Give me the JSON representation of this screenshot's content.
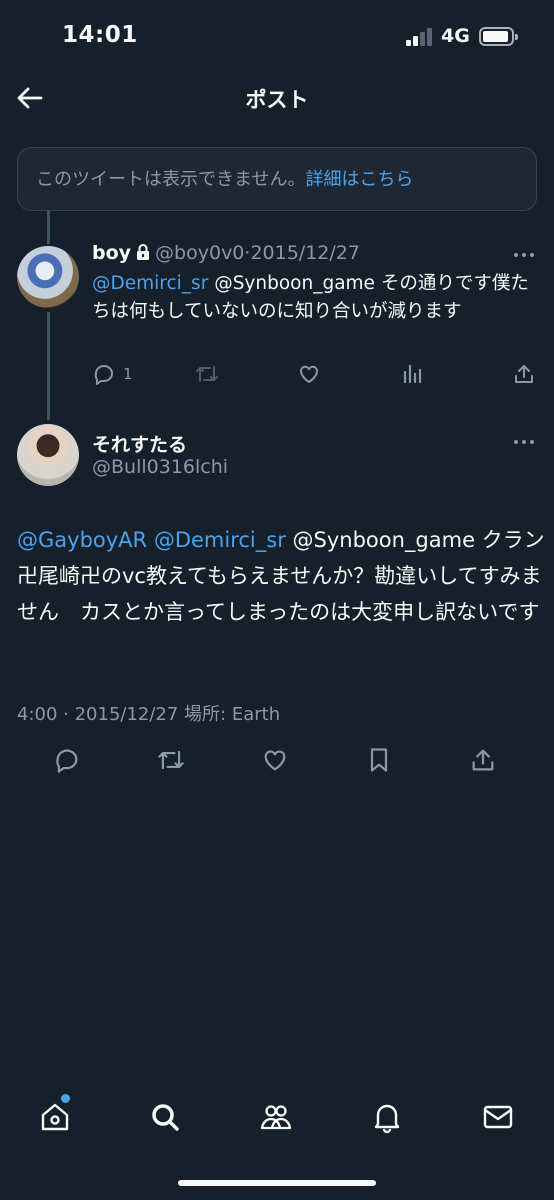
{
  "status_bar": {
    "time": "14:01",
    "network": "4G"
  },
  "header": {
    "title": "ポスト"
  },
  "unavailable_notice": {
    "text": "このツイートは表示できません。",
    "link": "詳細はこちら"
  },
  "reply_tweet": {
    "author_name": "boy",
    "handle": "@boy0v0",
    "separator": "·",
    "date": "2015/12/27",
    "mention": "@Demirci_sr",
    "text": "@Synboon_game その通りです僕たちは何もしていないのに知り合いが減ります",
    "reply_count": "1"
  },
  "main_tweet": {
    "author_name": "それすたる",
    "handle": "@Bull0316lchi",
    "mention_1": "@GayboyAR",
    "mention_2": "@Demirci_sr",
    "text": "@Synboon_game クラン卍尾崎卍のvc教えてもらえませんか？勘違いしてすみません　カスとか言ってしまったのは大変申し訳ないです",
    "meta": "4:00 · 2015/12/27 場所: Earth"
  },
  "colors": {
    "background": "#15202b",
    "accent": "#4aa3ef",
    "muted": "#8b98a5"
  },
  "icons": {
    "back": "arrow-left-icon",
    "lock": "lock-icon",
    "more": "more-horizontal-icon",
    "reply": "reply-icon",
    "retweet": "retweet-icon",
    "like": "heart-icon",
    "views": "analytics-icon",
    "share": "share-icon",
    "bookmark": "bookmark-icon",
    "tabs": [
      "home-icon",
      "search-icon",
      "communities-icon",
      "notifications-icon",
      "messages-icon"
    ]
  }
}
